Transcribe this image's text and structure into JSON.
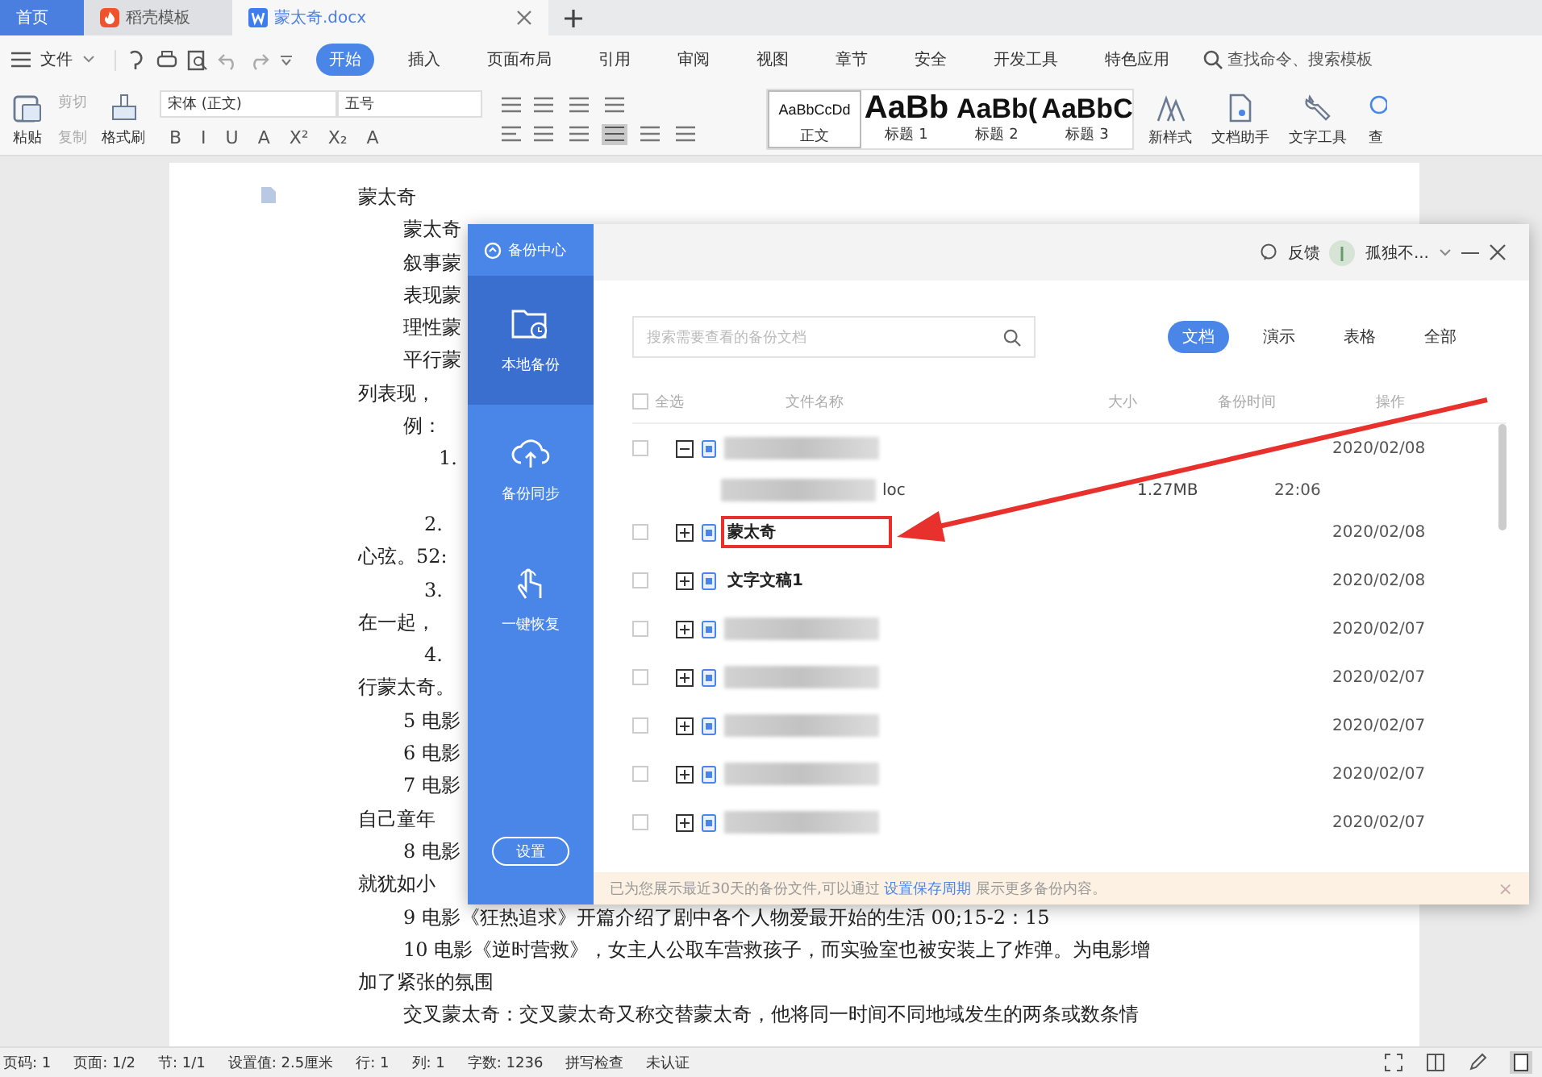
{
  "tabs": [
    {
      "label": "首页",
      "kind": "home",
      "selected": false
    },
    {
      "label": "稻壳模板",
      "kind": "template",
      "selected": false
    },
    {
      "label": "蒙太奇.docx",
      "kind": "doc",
      "selected": true
    }
  ],
  "menu": {
    "file": "文件",
    "tabs": [
      {
        "label": "开始",
        "selected": true
      },
      {
        "label": "插入",
        "selected": false
      },
      {
        "label": "页面布局",
        "selected": false
      },
      {
        "label": "引用",
        "selected": false
      },
      {
        "label": "审阅",
        "selected": false
      },
      {
        "label": "视图",
        "selected": false
      },
      {
        "label": "章节",
        "selected": false
      },
      {
        "label": "安全",
        "selected": false
      },
      {
        "label": "开发工具",
        "selected": false
      },
      {
        "label": "特色应用",
        "selected": false
      }
    ],
    "search_placeholder": "查找命令、搜索模板"
  },
  "toolbar": {
    "paste": "粘贴",
    "cut": "剪切",
    "copy": "复制",
    "format_painter": "格式刷",
    "font": "宋体 (正文)",
    "size": "五号",
    "format_glyphs": [
      "B",
      "I",
      "U",
      "A",
      "X²",
      "X₂",
      "A"
    ],
    "styles": [
      {
        "preview": "AaBbCcDd",
        "label": "正文",
        "selected": true
      },
      {
        "preview": "AaBb",
        "label": "标题 1",
        "selected": false
      },
      {
        "preview": "AaBb(",
        "label": "标题 2",
        "selected": false
      },
      {
        "preview": "AaBbC",
        "label": "标题 3",
        "selected": false
      }
    ],
    "new_style": "新样式",
    "doc_assistant": "文档助手",
    "text_tools": "文字工具",
    "find": "查"
  },
  "document": {
    "lines": [
      {
        "kind": "flush",
        "text": "蒙太奇"
      },
      {
        "kind": "indent",
        "text": "蒙太奇"
      },
      {
        "kind": "indent",
        "text": "叙事蒙"
      },
      {
        "kind": "indent",
        "text": "表现蒙"
      },
      {
        "kind": "indent",
        "text": "理性蒙"
      },
      {
        "kind": "indent",
        "text": "平行蒙"
      },
      {
        "kind": "flush",
        "text": "列表现，"
      },
      {
        "kind": "indent",
        "text": "例："
      },
      {
        "kind": "deep",
        "text": "1."
      },
      {
        "kind": "gap",
        "text": "2."
      },
      {
        "kind": "flush",
        "text": "心弦。52:"
      },
      {
        "kind": "number",
        "text": "3."
      },
      {
        "kind": "flush",
        "text": "在一起，"
      },
      {
        "kind": "number",
        "text": "4."
      },
      {
        "kind": "flush",
        "text": "行蒙太奇。"
      },
      {
        "kind": "indent",
        "text": "5 电影"
      },
      {
        "kind": "indent",
        "text": "6 电影"
      },
      {
        "kind": "indent",
        "text": "7 电影"
      },
      {
        "kind": "flush",
        "text": "自己童年"
      },
      {
        "kind": "indent",
        "text": "8 电影"
      },
      {
        "kind": "flush",
        "text": "就犹如小"
      },
      {
        "kind": "indent",
        "text": "9 电影《狂热追求》开篇介绍了剧中各个人物爱最开始的生活 00;15-2：15"
      },
      {
        "kind": "indent",
        "text": "10 电影《逆时营救》，女主人公取车营救孩子，而实验室也被安装上了炸弹。为电影增"
      },
      {
        "kind": "flush",
        "text": "加了紧张的氛围"
      },
      {
        "kind": "indent",
        "text": "交叉蒙太奇：交叉蒙太奇又称交替蒙太奇，他将同一时间不同地域发生的两条或数条情"
      }
    ]
  },
  "backup": {
    "title": "备份中心",
    "nav": [
      {
        "kind": "folder",
        "label": "本地备份",
        "selected": true
      },
      {
        "kind": "cloud",
        "label": "备份同步",
        "selected": false
      },
      {
        "kind": "hand",
        "label": "一键恢复",
        "selected": false
      }
    ],
    "settings": "设置",
    "feedback": "反馈",
    "user": "孤独不...",
    "search_placeholder": "搜索需要查看的备份文档",
    "filters": [
      {
        "label": "文档",
        "selected": true
      },
      {
        "label": "演示",
        "selected": false
      },
      {
        "label": "表格",
        "selected": false
      },
      {
        "label": "全部",
        "selected": false
      }
    ],
    "columns": [
      "全选",
      "文件名称",
      "大小",
      "备份时间",
      "操作"
    ],
    "select_all_checked": false,
    "rows": [
      {
        "kind": "group",
        "checked": false,
        "expanded": true,
        "blurred": true,
        "highlighted": false,
        "date": "2020/02/08"
      },
      {
        "kind": "version",
        "blurred": true,
        "suffix": "loc",
        "size": "1.27MB",
        "date": "22:06"
      },
      {
        "kind": "group",
        "checked": false,
        "expanded": false,
        "blurred": false,
        "name": "蒙太奇",
        "highlighted": true,
        "date": "2020/02/08"
      },
      {
        "kind": "group",
        "checked": false,
        "expanded": false,
        "blurred": false,
        "name": "文字文稿1",
        "highlighted": false,
        "date": "2020/02/08"
      },
      {
        "kind": "group",
        "checked": false,
        "expanded": false,
        "blurred": true,
        "highlighted": false,
        "date": "2020/02/07"
      },
      {
        "kind": "group",
        "checked": false,
        "expanded": false,
        "blurred": true,
        "highlighted": false,
        "date": "2020/02/07"
      },
      {
        "kind": "group",
        "checked": false,
        "expanded": false,
        "blurred": true,
        "highlighted": false,
        "date": "2020/02/07"
      },
      {
        "kind": "group",
        "checked": false,
        "expanded": false,
        "blurred": true,
        "highlighted": false,
        "date": "2020/02/07"
      },
      {
        "kind": "group",
        "checked": false,
        "expanded": false,
        "blurred": true,
        "highlighted": false,
        "date": "2020/02/07"
      }
    ],
    "notice": {
      "before": "已为您展示最近30天的备份文件,可以通过",
      "link": "设置保存周期",
      "after": "展示更多备份内容。",
      "close": "×"
    }
  },
  "status_bar": [
    "页码: 1",
    "页面: 1/2",
    "节: 1/1",
    "设置值: 2.5厘米",
    "行: 1",
    "列: 1",
    "字数: 1236",
    "拼写检查",
    "未认证"
  ]
}
